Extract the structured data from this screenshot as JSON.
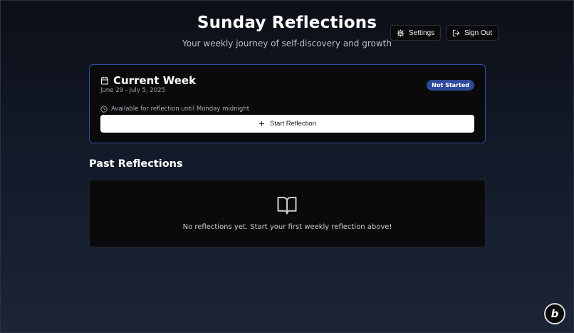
{
  "header": {
    "title": "Sunday Reflections",
    "subtitle": "Your weekly journey of self-discovery and growth"
  },
  "actions": {
    "settings_label": "Settings",
    "signout_label": "Sign Out"
  },
  "current_week": {
    "title": "Current Week",
    "dates": "June 29 - July 5, 2025",
    "status": "Not Started",
    "availability": "Available for reflection until Monday midnight",
    "start_label": "Start Reflection"
  },
  "past": {
    "title": "Past Reflections",
    "empty_message": "No reflections yet. Start your first weekly reflection above!"
  },
  "colors": {
    "accent": "#2c4fa8",
    "badge": "#2d4a9a",
    "card": "#0a0a0a"
  },
  "icons": [
    "gear-icon",
    "sign-out-icon",
    "calendar-icon",
    "clock-icon",
    "plus-icon",
    "book-open-icon",
    "brand-b-icon"
  ]
}
